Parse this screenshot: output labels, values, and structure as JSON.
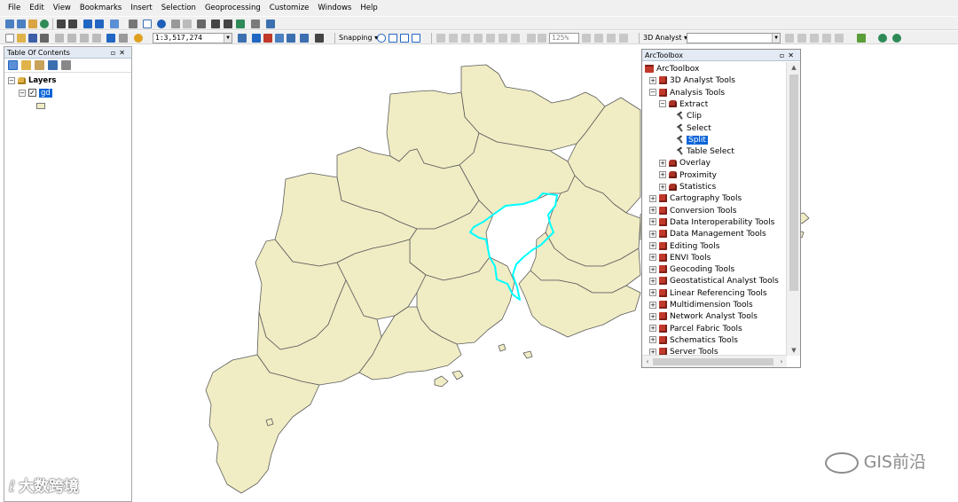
{
  "menu": [
    "File",
    "Edit",
    "View",
    "Bookmarks",
    "Insert",
    "Selection",
    "Geoprocessing",
    "Customize",
    "Windows",
    "Help"
  ],
  "toolbar": {
    "scale_value": "1:3,517,274",
    "snapping_label": "Snapping ▾",
    "zoom_value": "125%",
    "analyst_label": "3D Analyst ▾"
  },
  "toc": {
    "title": "Table Of Contents",
    "root_label": "Layers",
    "layer_label": "gd",
    "layer_checked": "✓"
  },
  "toolbox": {
    "title": "ArcToolbox",
    "root_label": "ArcToolbox",
    "items": [
      {
        "label": "3D Analyst Tools",
        "kind": "toolbox",
        "indent": 0,
        "expanded": "+"
      },
      {
        "label": "Analysis Tools",
        "kind": "toolbox",
        "indent": 0,
        "expanded": "−"
      },
      {
        "label": "Extract",
        "kind": "toolset",
        "indent": 1,
        "expanded": "−"
      },
      {
        "label": "Clip",
        "kind": "tool",
        "indent": 2
      },
      {
        "label": "Select",
        "kind": "tool",
        "indent": 2
      },
      {
        "label": "Split",
        "kind": "tool",
        "indent": 2,
        "selected": true
      },
      {
        "label": "Table Select",
        "kind": "tool",
        "indent": 2
      },
      {
        "label": "Overlay",
        "kind": "toolset",
        "indent": 1,
        "expanded": "+"
      },
      {
        "label": "Proximity",
        "kind": "toolset",
        "indent": 1,
        "expanded": "+"
      },
      {
        "label": "Statistics",
        "kind": "toolset",
        "indent": 1,
        "expanded": "+"
      },
      {
        "label": "Cartography Tools",
        "kind": "toolbox",
        "indent": 0,
        "expanded": "+"
      },
      {
        "label": "Conversion Tools",
        "kind": "toolbox",
        "indent": 0,
        "expanded": "+"
      },
      {
        "label": "Data Interoperability Tools",
        "kind": "toolbox",
        "indent": 0,
        "expanded": "+"
      },
      {
        "label": "Data Management Tools",
        "kind": "toolbox",
        "indent": 0,
        "expanded": "+"
      },
      {
        "label": "Editing Tools",
        "kind": "toolbox",
        "indent": 0,
        "expanded": "+"
      },
      {
        "label": "ENVI Tools",
        "kind": "toolbox",
        "indent": 0,
        "expanded": "+"
      },
      {
        "label": "Geocoding Tools",
        "kind": "toolbox",
        "indent": 0,
        "expanded": "+"
      },
      {
        "label": "Geostatistical Analyst Tools",
        "kind": "toolbox",
        "indent": 0,
        "expanded": "+"
      },
      {
        "label": "Linear Referencing Tools",
        "kind": "toolbox",
        "indent": 0,
        "expanded": "+"
      },
      {
        "label": "Multidimension Tools",
        "kind": "toolbox",
        "indent": 0,
        "expanded": "+"
      },
      {
        "label": "Network Analyst Tools",
        "kind": "toolbox",
        "indent": 0,
        "expanded": "+"
      },
      {
        "label": "Parcel Fabric Tools",
        "kind": "toolbox",
        "indent": 0,
        "expanded": "+"
      },
      {
        "label": "Schematics Tools",
        "kind": "toolbox",
        "indent": 0,
        "expanded": "+"
      },
      {
        "label": "Server Tools",
        "kind": "toolbox",
        "indent": 0,
        "expanded": "+"
      }
    ]
  },
  "map": {
    "fill_color": "#f0ecc4",
    "outline_color": "#5c5c5c",
    "highlight_color": "#00ffff"
  },
  "watermarks": {
    "right": "GIS前沿",
    "left": "大数跨境"
  }
}
